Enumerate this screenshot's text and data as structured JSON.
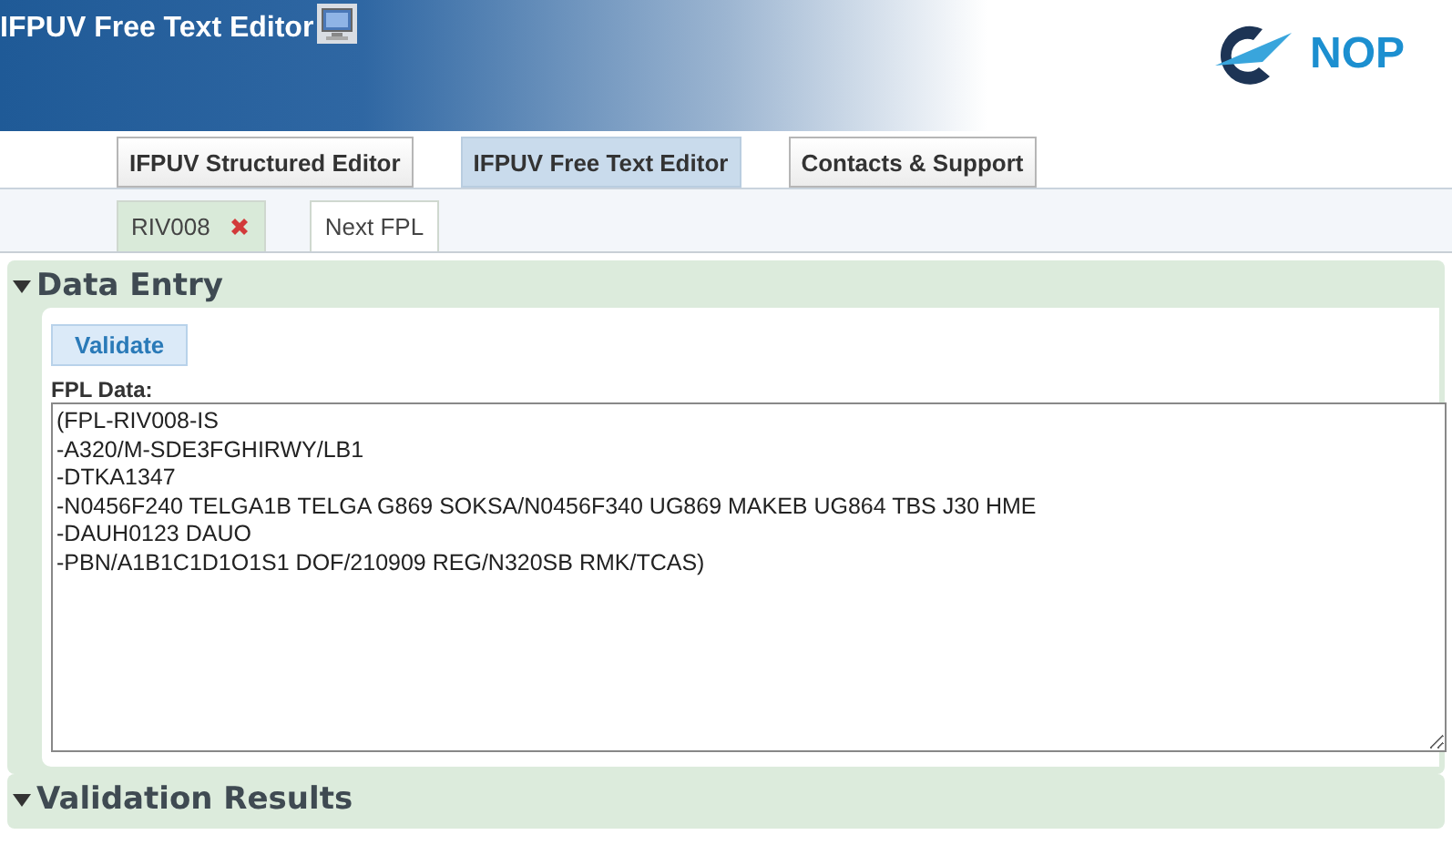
{
  "header": {
    "title": "IFPUV Free Text Editor",
    "logo_text": "NOP"
  },
  "nav_tabs": [
    {
      "label": "IFPUV Structured Editor",
      "selected": false
    },
    {
      "label": "IFPUV Free Text Editor",
      "selected": true
    },
    {
      "label": "Contacts & Support",
      "selected": false
    }
  ],
  "flight_tabs": [
    {
      "label": "RIV008",
      "selected": true,
      "closable": true
    },
    {
      "label": "Next FPL",
      "selected": false,
      "closable": false
    }
  ],
  "sections": [
    {
      "title": "Data Entry",
      "expanded": true,
      "button": "Validate",
      "field_label": "FPL Data:",
      "field_value": "(FPL-RIV008-IS\n-A320/M-SDE3FGHIRWY/LB1\n-DTKA1347\n-N0456F240 TELGA1B TELGA G869 SOKSA/N0456F340 UG869 MAKEB UG864 TBS J30 HME\n-DAUH0123 DAUO\n-PBN/A1B1C1D1O1S1 DOF/210909 REG/N320SB RMK/TCAS)"
    },
    {
      "title": "Validation Results",
      "expanded": true
    }
  ]
}
